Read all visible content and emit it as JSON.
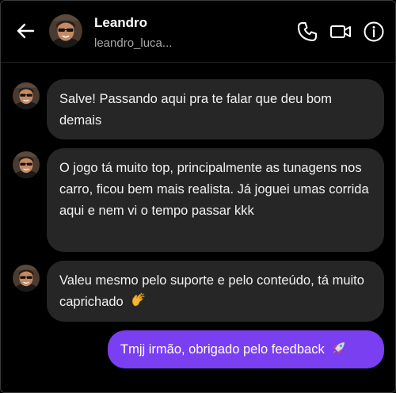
{
  "header": {
    "name": "Leandro",
    "username": "leandro_luca...",
    "icons": [
      "back-arrow-icon",
      "phone-icon",
      "video-camera-icon",
      "info-icon"
    ]
  },
  "messages": [
    {
      "direction": "incoming",
      "text": "Salve! Passando aqui pra te falar que deu bom demais"
    },
    {
      "direction": "incoming",
      "text": "O jogo tá muito top, principalmente as tunagens nos carro, ficou bem mais realista. Já joguei umas corrida aqui e nem vi o tempo passar kkk"
    },
    {
      "direction": "incoming",
      "text": "Valeu mesmo pelo suporte e pelo conteúdo, tá muito caprichado",
      "emoji": "clapping-hands-icon"
    },
    {
      "direction": "outgoing",
      "text": "Tmjj irmão, obrigado pelo feedback",
      "emoji": "rocket-icon"
    }
  ],
  "colors": {
    "background": "#000000",
    "incoming_bubble": "#262626",
    "outgoing_bubble": "#7b3ff2",
    "secondary_text": "#a8a8a8"
  }
}
